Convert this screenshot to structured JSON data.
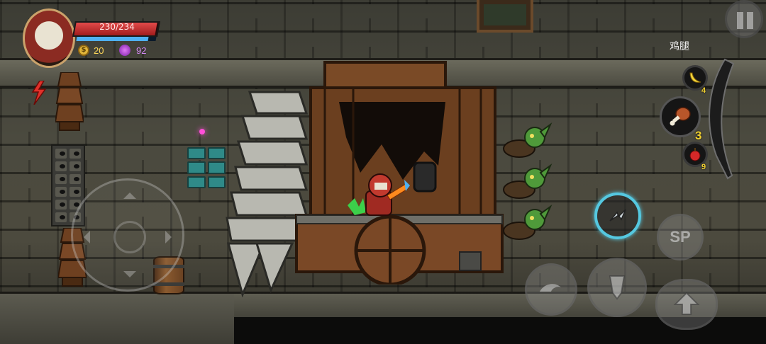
{
  "player": {
    "hp_text": "230/234",
    "hp_fraction": 0.983,
    "mp_fraction": 0.9,
    "gold": "20",
    "souls": "92"
  },
  "item_wheel": {
    "selected_label": "鸡腿",
    "items": [
      {
        "icon": "banana-icon",
        "count": "4"
      },
      {
        "icon": "chicken-leg-icon",
        "count": "3"
      },
      {
        "icon": "apple-icon",
        "count": "9"
      }
    ]
  },
  "controls": {
    "sp_label": "SP"
  },
  "colors": {
    "hp": "#c62a2a",
    "mp": "#4fb0f0",
    "gold": "#ffd85a",
    "souls": "#d58af5",
    "skill_ring": "#55c8e0"
  }
}
